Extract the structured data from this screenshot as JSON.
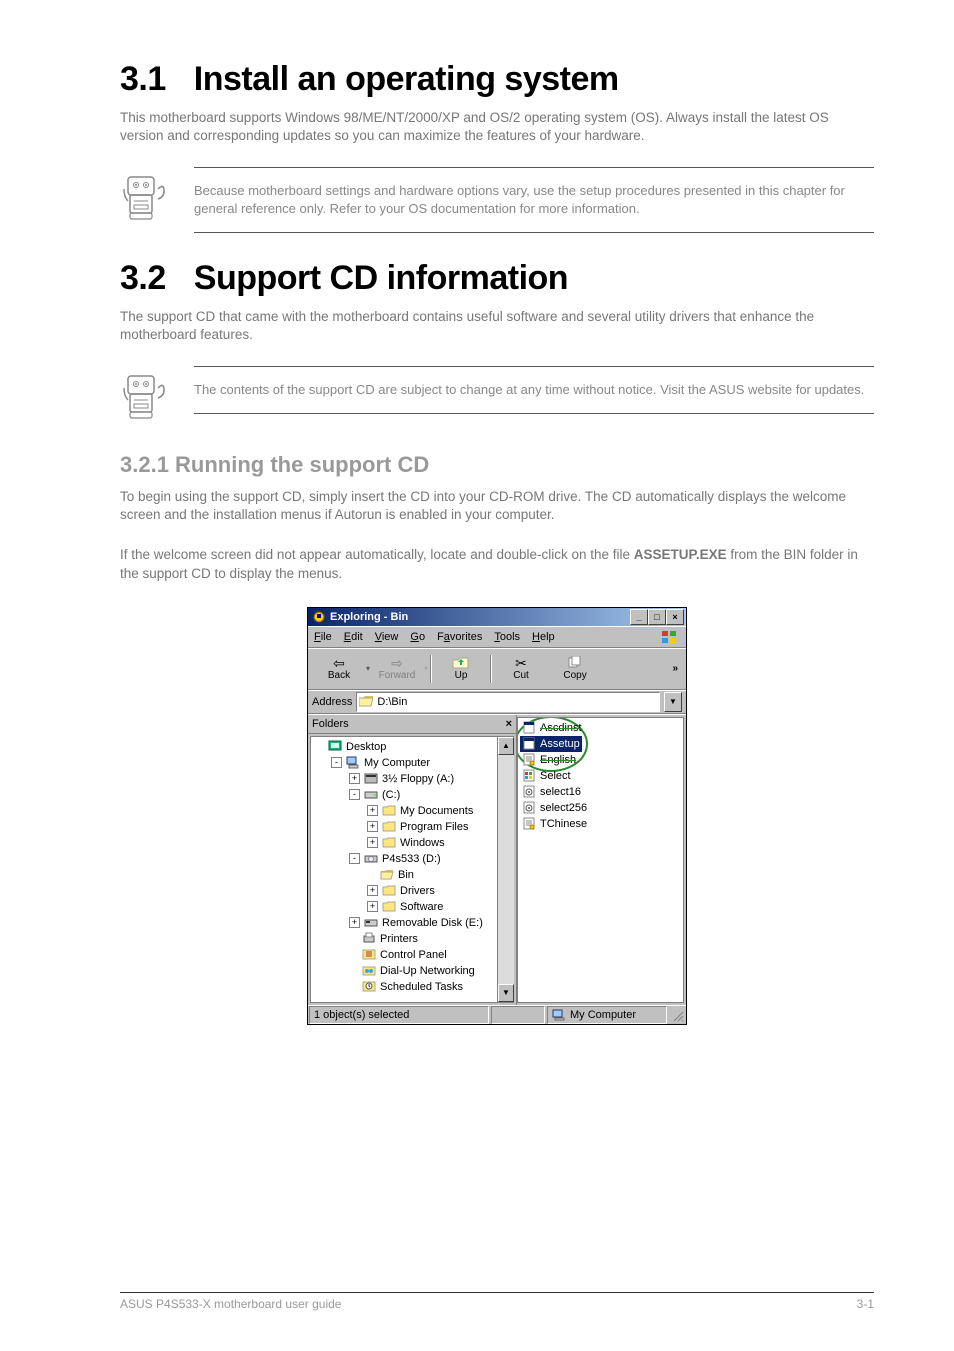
{
  "section1": {
    "num": "3.1",
    "title": "Install an operating system",
    "para": "This motherboard supports Windows 98/ME/NT/2000/XP and OS/2 operating system (OS). Always install the latest OS version and corresponding updates so you can maximize the features of your hardware.",
    "note": "Because motherboard settings and hardware options vary, use the setup procedures presented in this chapter for general reference only. Refer to your OS documentation for more information."
  },
  "section2": {
    "num": "3.2",
    "title": "Support CD information",
    "para": "The support CD that came with the motherboard contains useful software and several utility drivers that enhance the motherboard features.",
    "note": "The contents of the support CD are subject to change at any time without notice. Visit the ASUS website for updates."
  },
  "subsection": {
    "num_title": "3.2.1  Running the support CD",
    "para1": "To begin using the support CD, simply insert the CD into your CD-ROM drive. The CD automatically displays the welcome screen and the installation menus if Autorun is enabled in your computer.",
    "para2a": "If the welcome screen did not appear automatically, locate and double-click on the file ",
    "para2b": " from the BIN folder in the support CD to display the menus.",
    "assetup": "ASSETUP.EXE"
  },
  "explorer": {
    "title": "Exploring - Bin",
    "sysbuttons": {
      "min": "_",
      "max": "□",
      "close": "×"
    },
    "menu": [
      "File",
      "Edit",
      "View",
      "Go",
      "Favorites",
      "Tools",
      "Help"
    ],
    "toolbar": {
      "back": "Back",
      "forward": "Forward",
      "up": "Up",
      "cut": "Cut",
      "copy": "Copy",
      "more": "»"
    },
    "address": {
      "label": "Address",
      "value": "D:\\Bin"
    },
    "folders_header": "Folders",
    "tree": [
      {
        "indent": 0,
        "exp": "",
        "icon": "desktop",
        "label": "Desktop"
      },
      {
        "indent": 1,
        "exp": "-",
        "icon": "mycomputer",
        "label": "My Computer"
      },
      {
        "indent": 2,
        "exp": "+",
        "icon": "floppy",
        "label": "3½ Floppy (A:)"
      },
      {
        "indent": 2,
        "exp": "-",
        "icon": "hdd",
        "label": "(C:)"
      },
      {
        "indent": 3,
        "exp": "+",
        "icon": "folder",
        "label": "My Documents"
      },
      {
        "indent": 3,
        "exp": "+",
        "icon": "folder",
        "label": "Program Files"
      },
      {
        "indent": 3,
        "exp": "+",
        "icon": "folder",
        "label": "Windows"
      },
      {
        "indent": 2,
        "exp": "-",
        "icon": "cd",
        "label": "P4s533 (D:)"
      },
      {
        "indent": 3,
        "exp": "",
        "icon": "folder-open",
        "label": "Bin"
      },
      {
        "indent": 3,
        "exp": "+",
        "icon": "folder",
        "label": "Drivers"
      },
      {
        "indent": 3,
        "exp": "+",
        "icon": "folder",
        "label": "Software"
      },
      {
        "indent": 2,
        "exp": "+",
        "icon": "removable",
        "label": "Removable Disk (E:)"
      },
      {
        "indent": 2,
        "exp": "",
        "icon": "printers",
        "label": "Printers"
      },
      {
        "indent": 2,
        "exp": "",
        "icon": "control",
        "label": "Control Panel"
      },
      {
        "indent": 2,
        "exp": "",
        "icon": "dialup",
        "label": "Dial-Up Networking"
      },
      {
        "indent": 2,
        "exp": "",
        "icon": "tasks",
        "label": "Scheduled Tasks"
      }
    ],
    "files": [
      {
        "icon": "exe",
        "label": "Ascdinst",
        "sel": false,
        "ring": true
      },
      {
        "icon": "exe",
        "label": "Assetup",
        "sel": true,
        "ring": true
      },
      {
        "icon": "ini",
        "label": "English",
        "sel": false,
        "ring": true
      },
      {
        "icon": "exe2",
        "label": "Select",
        "sel": false,
        "ring": false
      },
      {
        "icon": "cfg",
        "label": "select16",
        "sel": false,
        "ring": false
      },
      {
        "icon": "cfg",
        "label": "select256",
        "sel": false,
        "ring": false
      },
      {
        "icon": "ini",
        "label": "TChinese",
        "sel": false,
        "ring": false
      }
    ],
    "status": {
      "left": "1 object(s) selected",
      "right": "My Computer"
    }
  },
  "footer": {
    "left": "ASUS P4S533-X motherboard user guide",
    "right": "3-1"
  }
}
